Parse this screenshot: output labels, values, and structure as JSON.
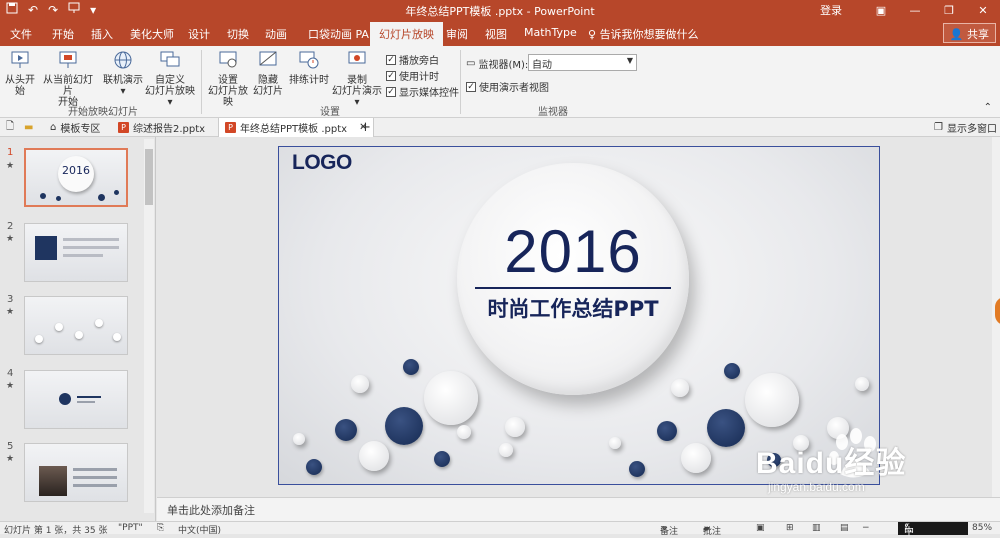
{
  "titlebar": {
    "title": "年终总结PPT模板 .pptx  -  PowerPoint",
    "login": "登录",
    "quick_access": [
      "save-icon",
      "undo-icon",
      "redo-icon",
      "start-from-beginning-icon",
      "customize-qat-icon"
    ]
  },
  "tabs": [
    "文件",
    "开始",
    "插入",
    "美化大师",
    "设计",
    "切换",
    "动画",
    "口袋动画 PA",
    "幻灯片放映",
    "审阅",
    "视图",
    "MathType"
  ],
  "active_tab": "幻灯片放映",
  "tell_me": "告诉我你想要做什么",
  "share": "共享",
  "ribbon": {
    "start": {
      "btn1": "从头开始",
      "btn2_l1": "从当前幻灯片",
      "btn2_l2": "开始",
      "btn3": "联机演示",
      "btn4_l1": "自定义",
      "btn4_l2": "幻灯片放映",
      "label": "开始放映幻灯片"
    },
    "setup": {
      "btn1_l1": "设置",
      "btn1_l2": "幻灯片放映",
      "btn2_l1": "隐藏",
      "btn2_l2": "幻灯片",
      "btn3": "排练计时",
      "btn4_l1": "录制",
      "btn4_l2": "幻灯片演示",
      "label": "设置"
    },
    "checks": [
      "播放旁白",
      "使用计时",
      "显示媒体控件"
    ],
    "monitor": {
      "label": "监视器(M):",
      "value": "自动",
      "presenter_view": "使用演示者视图",
      "group_label": "监视器"
    }
  },
  "doctabs": {
    "tab1": "模板专区",
    "tab2": "综述报告2.pptx",
    "tab3": "年终总结PPT模板 .pptx",
    "multi_window": "显示多窗口"
  },
  "thumbnails": [
    {
      "num": "1",
      "star": "★"
    },
    {
      "num": "2",
      "star": "★"
    },
    {
      "num": "3",
      "star": "★"
    },
    {
      "num": "4",
      "star": "★"
    },
    {
      "num": "5",
      "star": "★"
    }
  ],
  "slide": {
    "logo": "LOGO",
    "year": "2016",
    "subtitle": "时尚工作总结PPT"
  },
  "notes_placeholder": "单击此处添加备注",
  "status": {
    "slide_info": "幻灯片 第 1 张，共 35 张",
    "theme": "\"PPT\"",
    "language": "中文(中国)",
    "notes_btn": "备注",
    "comments_btn": "批注",
    "zoom": "85%",
    "ime": "中"
  },
  "watermark": {
    "brand": "Baidu经验",
    "url": "jingyan.baidu.com"
  },
  "colors": {
    "accent": "#b7472a",
    "slide_navy": "#17255a",
    "selection": "#e07a57"
  }
}
